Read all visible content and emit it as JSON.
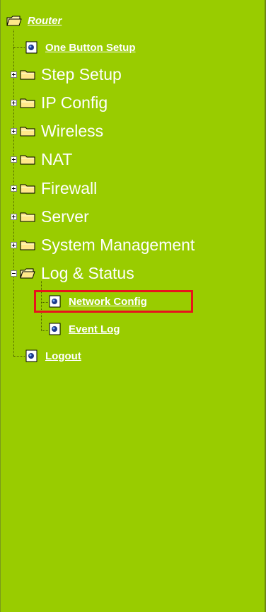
{
  "root": {
    "label": "Router",
    "icon": "open-folder-icon"
  },
  "items": [
    {
      "label": "One Button Setup",
      "icon": "page-icon",
      "type": "link"
    },
    {
      "label": "Step Setup",
      "icon": "folder-icon",
      "type": "folder",
      "expanded": false
    },
    {
      "label": "IP Config",
      "icon": "folder-icon",
      "type": "folder",
      "expanded": false
    },
    {
      "label": "Wireless",
      "icon": "folder-icon",
      "type": "folder",
      "expanded": false
    },
    {
      "label": "NAT",
      "icon": "folder-icon",
      "type": "folder",
      "expanded": false
    },
    {
      "label": "Firewall",
      "icon": "folder-icon",
      "type": "folder",
      "expanded": false
    },
    {
      "label": "Server",
      "icon": "folder-icon",
      "type": "folder",
      "expanded": false
    },
    {
      "label": "System Management",
      "icon": "folder-icon",
      "type": "folder",
      "expanded": false
    },
    {
      "label": "Log & Status",
      "icon": "open-folder-icon",
      "type": "folder",
      "expanded": true,
      "children": [
        {
          "label": "Network Config",
          "icon": "page-icon",
          "selected": true
        },
        {
          "label": "Event Log",
          "icon": "page-icon"
        }
      ]
    },
    {
      "label": "Logout",
      "icon": "page-icon",
      "type": "link"
    }
  ],
  "colors": {
    "panel": "#99cc00",
    "text": "#ffffff",
    "highlight": "#e8141c"
  }
}
